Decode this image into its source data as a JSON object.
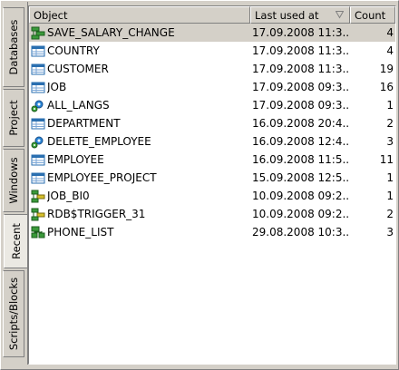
{
  "tabs": [
    {
      "label": "Databases",
      "active": false
    },
    {
      "label": "Project",
      "active": false
    },
    {
      "label": "Windows",
      "active": false
    },
    {
      "label": "Recent",
      "active": true
    },
    {
      "label": "Scripts/Blocks",
      "active": false
    }
  ],
  "columns": {
    "object": "Object",
    "last_used": "Last used at",
    "count": "Count"
  },
  "rows": [
    {
      "icon": "procedure-icon",
      "name": "SAVE_SALARY_CHANGE",
      "date": "17.09.2008 11:3...",
      "count": "4",
      "selected": true
    },
    {
      "icon": "table-icon",
      "name": "COUNTRY",
      "date": "17.09.2008 11:3...",
      "count": "4"
    },
    {
      "icon": "table-icon",
      "name": "CUSTOMER",
      "date": "17.09.2008 11:3...",
      "count": "19"
    },
    {
      "icon": "table-icon",
      "name": "JOB",
      "date": "17.09.2008 09:3...",
      "count": "16"
    },
    {
      "icon": "procedure-gear-icon",
      "name": "ALL_LANGS",
      "date": "17.09.2008 09:3...",
      "count": "1"
    },
    {
      "icon": "table-icon",
      "name": "DEPARTMENT",
      "date": "16.09.2008 20:4...",
      "count": "2"
    },
    {
      "icon": "procedure-gear-icon",
      "name": "DELETE_EMPLOYEE",
      "date": "16.09.2008 12:4...",
      "count": "3"
    },
    {
      "icon": "table-icon",
      "name": "EMPLOYEE",
      "date": "16.09.2008 11:5...",
      "count": "11"
    },
    {
      "icon": "table-icon",
      "name": "EMPLOYEE_PROJECT",
      "date": "15.09.2008 12:5...",
      "count": "1"
    },
    {
      "icon": "trigger-icon",
      "name": "JOB_BI0",
      "date": "10.09.2008 09:2...",
      "count": "1"
    },
    {
      "icon": "trigger-icon",
      "name": "RDB$TRIGGER_31",
      "date": "10.09.2008 09:2...",
      "count": "2"
    },
    {
      "icon": "view-icon",
      "name": "PHONE_LIST",
      "date": "29.08.2008 10:3...",
      "count": "3"
    }
  ]
}
